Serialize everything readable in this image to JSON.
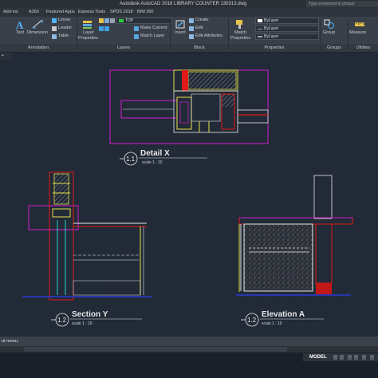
{
  "window": {
    "title": "Autodesk AutoCAD 2018   LIBRARY COUNTER 130313.dwg",
    "search_placeholder": "Type a keyword or phrase"
  },
  "tabs": [
    "Add-ins",
    "A360",
    "Featured Apps",
    "Express Tools",
    "SPDS 2018",
    "BIM 360"
  ],
  "ribbon": {
    "annotation": {
      "panel": "Annotation",
      "text": "Text",
      "dimension": "Dimension",
      "linear": "Linear",
      "leader": "Leader",
      "table": "Table"
    },
    "layers": {
      "panel": "Layers",
      "layer_properties_1": "Layer",
      "layer_properties_2": "Properties",
      "current_layer": "TOP",
      "make_current": "Make Current",
      "match_layer": "Match Layer"
    },
    "block": {
      "panel": "Block",
      "insert": "Insert",
      "create": "Create",
      "edit": "Edit",
      "edit_attributes": "Edit Attributes"
    },
    "properties": {
      "panel": "Properties",
      "match_1": "Match",
      "match_2": "Properties",
      "color": "ByLayer",
      "linetype": "ByLayer",
      "lineweight": "ByLayer"
    },
    "groups": {
      "panel": "Groups",
      "group": "Group"
    },
    "utilities": {
      "panel": "Utilities",
      "measure": "Measure"
    }
  },
  "file_tab": "+",
  "drawing": {
    "detail": {
      "num": "1.1",
      "title": "Detail X",
      "scale": "scale 1 : 10"
    },
    "section": {
      "num": "1.2",
      "title": "Section Y",
      "scale": "scale 1 : 10"
    },
    "elevation": {
      "num": "1.2",
      "title": "Elevation A",
      "scale": "scale 1 : 10"
    }
  },
  "command_line": "ut menu.",
  "status": {
    "model": "MODEL"
  },
  "colors": {
    "magenta": "#d21ed2",
    "red": "#e01b1b",
    "yellow": "#e6e04a",
    "cyan": "#27d3d3",
    "blue": "#2a3ad9",
    "white": "#e8e8e8",
    "background": "#212a36"
  }
}
